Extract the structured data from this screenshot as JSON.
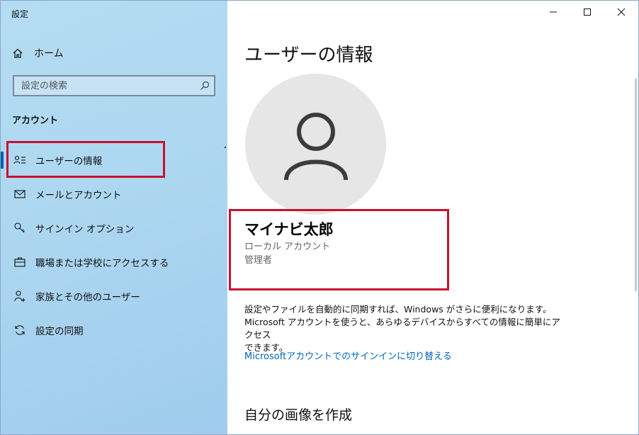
{
  "window": {
    "title": "設定"
  },
  "sidebar": {
    "home_label": "ホーム",
    "search_placeholder": "設定の検索",
    "section_title": "アカウント",
    "items": [
      {
        "label": "ユーザーの情報",
        "icon": "user-info-icon",
        "active": true
      },
      {
        "label": "メールとアカウント",
        "icon": "mail-icon",
        "active": false
      },
      {
        "label": "サインイン オプション",
        "icon": "key-icon",
        "active": false
      },
      {
        "label": "職場または学校にアクセスする",
        "icon": "briefcase-icon",
        "active": false
      },
      {
        "label": "家族とその他のユーザー",
        "icon": "person-add-icon",
        "active": false
      },
      {
        "label": "設定の同期",
        "icon": "sync-icon",
        "active": false
      }
    ]
  },
  "content": {
    "page_title": "ユーザーの情報",
    "user": {
      "name": "マイナビ太郎",
      "account_type": "ローカル アカウント",
      "role": "管理者"
    },
    "info_line1": "設定やファイルを自動的に同期すれば、Windows がさらに便利になります。",
    "info_line2": "Microsoft アカウントを使うと、あらゆるデバイスからすべての情報に簡単にアクセス",
    "info_line3": "できます。",
    "link_label": "Microsoftアカウントでのサインインに切り替える",
    "section2_title": "自分の画像を作成"
  },
  "colors": {
    "accent": "#0063b1",
    "link": "#0066b4",
    "highlight": "#c8102e"
  }
}
